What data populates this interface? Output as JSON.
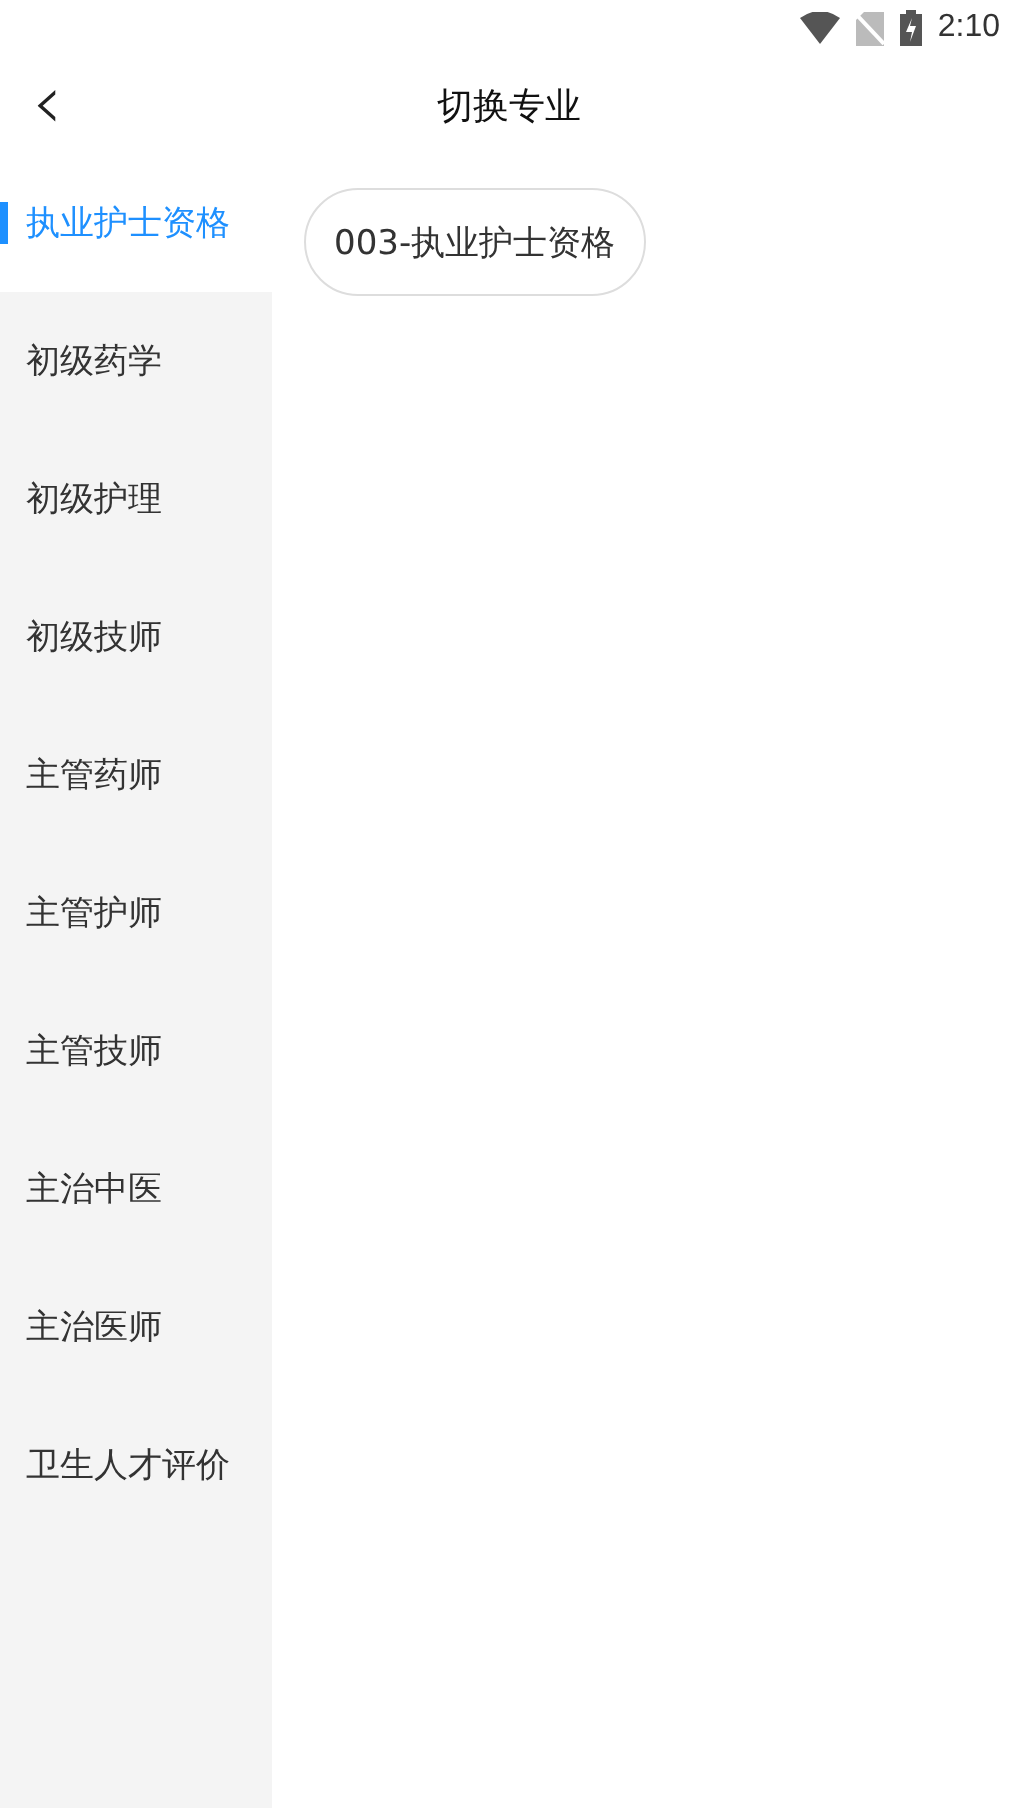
{
  "status_bar": {
    "time": "2:10"
  },
  "header": {
    "back": "‹",
    "title": "切换专业"
  },
  "sidebar": {
    "items": [
      {
        "label": "执业护士资格",
        "selected": true
      },
      {
        "label": "初级药学",
        "selected": false
      },
      {
        "label": "初级护理",
        "selected": false
      },
      {
        "label": "初级技师",
        "selected": false
      },
      {
        "label": "主管药师",
        "selected": false
      },
      {
        "label": "主管护师",
        "selected": false
      },
      {
        "label": "主管技师",
        "selected": false
      },
      {
        "label": "主治中医",
        "selected": false
      },
      {
        "label": "主治医师",
        "selected": false
      },
      {
        "label": "卫生人才评价",
        "selected": false
      }
    ]
  },
  "options": [
    {
      "label": "003-执业护士资格"
    }
  ]
}
